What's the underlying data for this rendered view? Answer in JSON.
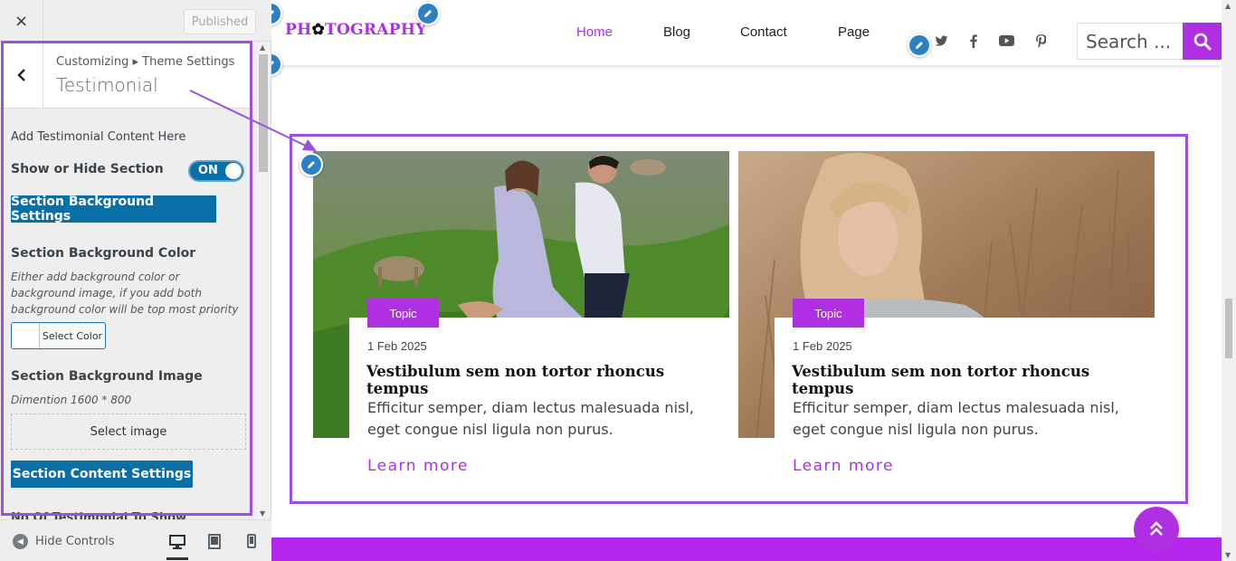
{
  "customizer": {
    "close_label": "×",
    "published_label": "Published",
    "breadcrumb": "Customizing ▸ Theme Settings",
    "panel_title": "Testimonial",
    "intro": "Add Testimonial Content Here",
    "show_hide_label": "Show or Hide Section",
    "toggle_label": "ON",
    "bg_settings_button": "Section Background Settings",
    "bg_color_label": "Section Background Color",
    "bg_color_desc": "Either add background color or background image, if you add both background color will be top most priority",
    "select_color_label": "Select Color",
    "bg_image_label": "Section Background Image",
    "bg_image_desc": "Dimention 1600 * 800",
    "select_image_label": "Select image",
    "content_settings_button": "Section Content Settings",
    "partial_text": "No Of Testimonial To Show",
    "hide_controls_label": "Hide Controls"
  },
  "site": {
    "logo": {
      "before": "PH",
      "aperture": "✿",
      "middle": "TO",
      "after": "GRAPHY"
    },
    "nav": [
      {
        "label": "Home",
        "active": true
      },
      {
        "label": "Blog",
        "active": false
      },
      {
        "label": "Contact",
        "active": false
      },
      {
        "label": "Page",
        "active": false
      }
    ],
    "social_icons": [
      "twitter-icon",
      "facebook-icon",
      "youtube-icon",
      "pinterest-icon"
    ],
    "search_placeholder": "Search ...",
    "cards": [
      {
        "image": "couple-on-hillside-photo",
        "topic": "Topic",
        "date": "1 Feb 2025",
        "title": "Vestibulum sem non tortor rhoncus tempus",
        "excerpt": "Efficitur semper, diam lectus malesuada nisl, eget congue nisl ligula non purus.",
        "link": "Learn more"
      },
      {
        "image": "woman-in-dry-grass-photo",
        "topic": "Topic",
        "date": "1 Feb 2025",
        "title": "Vestibulum sem non tortor rhoncus tempus",
        "excerpt": "Efficitur semper, diam lectus malesuada nisl, eget congue nisl ligula non purus.",
        "link": "Learn more"
      }
    ]
  },
  "colors": {
    "accent": "#b02fe3",
    "highlight": "#9b51e0",
    "wp_blue": "#0a6fa6"
  }
}
